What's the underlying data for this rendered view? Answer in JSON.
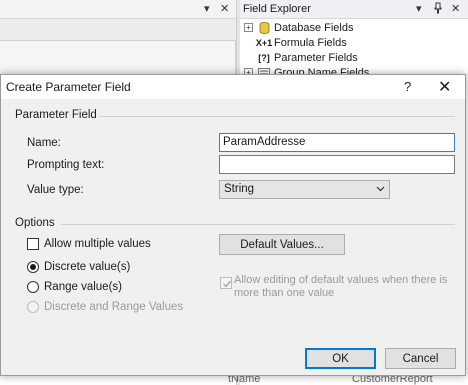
{
  "background": {
    "left_close": "✕",
    "field_explorer": {
      "title": "Field Explorer",
      "controls": [
        "▾",
        "⊣",
        "✕"
      ],
      "items": [
        {
          "label": "Database Fields",
          "icon_text": ""
        },
        {
          "label": "Formula Fields",
          "icon_text": "X+1"
        },
        {
          "label": "Parameter Fields",
          "icon_text": "[?]"
        },
        {
          "label": "Group Name Fields",
          "icon_text": ""
        }
      ]
    },
    "bottom_left": "tName",
    "bottom_right": "CustomerReport"
  },
  "dialog": {
    "title": "Create Parameter Field",
    "help": "?",
    "close": "✕",
    "parameter_section": "Parameter Field",
    "name_label": "Name:",
    "name_value": "ParamAddresse",
    "prompting_label": "Prompting text:",
    "prompting_value": "",
    "value_type_label": "Value type:",
    "value_type_value": "String",
    "options_section": "Options",
    "allow_multiple": "Allow multiple values",
    "default_values_button": "Default Values...",
    "discrete": "Discrete value(s)",
    "range": "Range value(s)",
    "discrete_and_range": "Discrete and Range Values",
    "allow_editing": "Allow editing of default values when there is more than one value",
    "ok": "OK",
    "cancel": "Cancel"
  },
  "colors": {
    "focus": "#3c7fb1",
    "default_button": "#0078d7",
    "dialog_bg": "#f0f0f0"
  }
}
